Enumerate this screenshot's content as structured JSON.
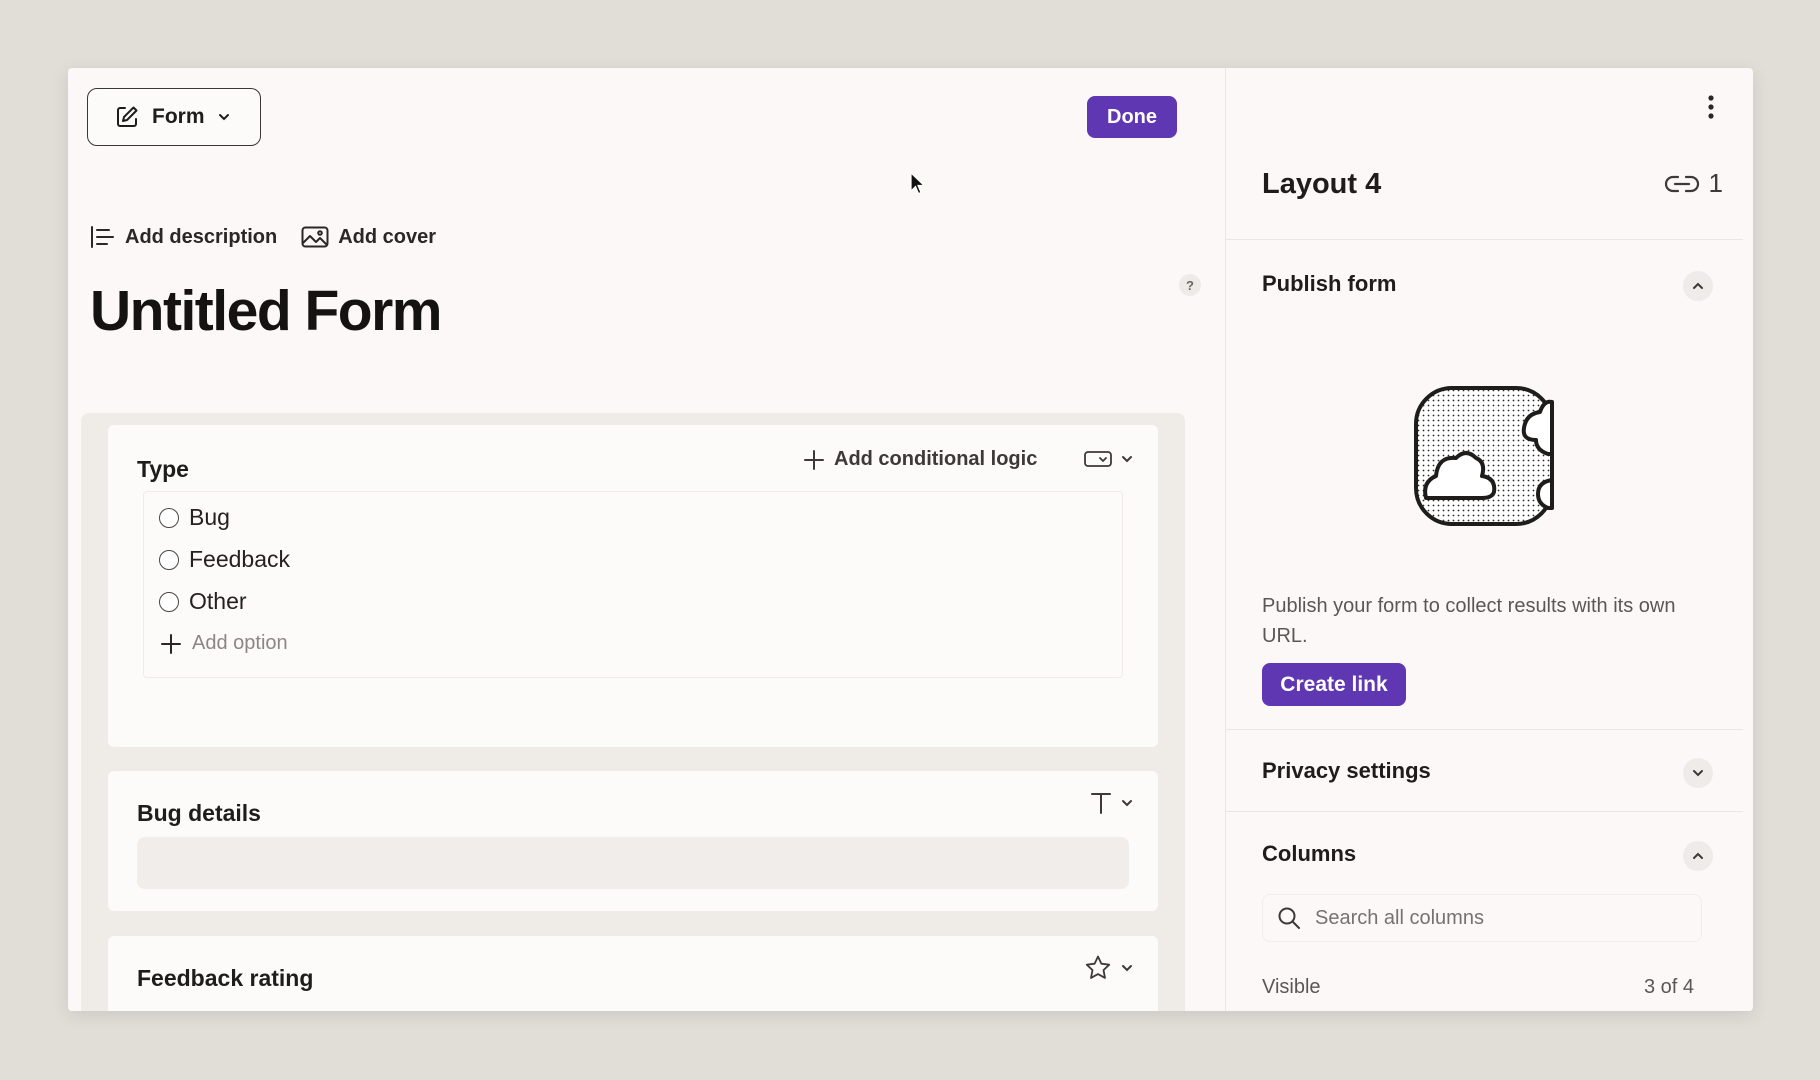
{
  "toolbar": {
    "view_label": "Form",
    "done_label": "Done"
  },
  "form": {
    "add_description": "Add description",
    "add_cover": "Add cover",
    "title": "Untitled Form",
    "help": "?"
  },
  "questions": [
    {
      "label": "Type",
      "conditional_logic": "Add conditional logic",
      "field_type_icon": "select-icon",
      "options": [
        "Bug",
        "Feedback",
        "Other"
      ],
      "add_option": "Add option"
    },
    {
      "label": "Bug details",
      "field_type_icon": "text-icon"
    },
    {
      "label": "Feedback rating",
      "field_type_icon": "star-icon"
    }
  ],
  "panel": {
    "title": "Layout 4",
    "link_count": "1",
    "publish": {
      "title": "Publish form",
      "description": "Publish your form to collect results with its own URL.",
      "create_link": "Create link"
    },
    "privacy": {
      "title": "Privacy settings"
    },
    "columns": {
      "title": "Columns",
      "search_placeholder": "Search all columns",
      "visible_label": "Visible",
      "visible_count": "3 of 4"
    }
  },
  "colors": {
    "accent": "#5f37b2",
    "window_bg": "#fbf8f7",
    "desk_bg": "#e1ded8"
  }
}
